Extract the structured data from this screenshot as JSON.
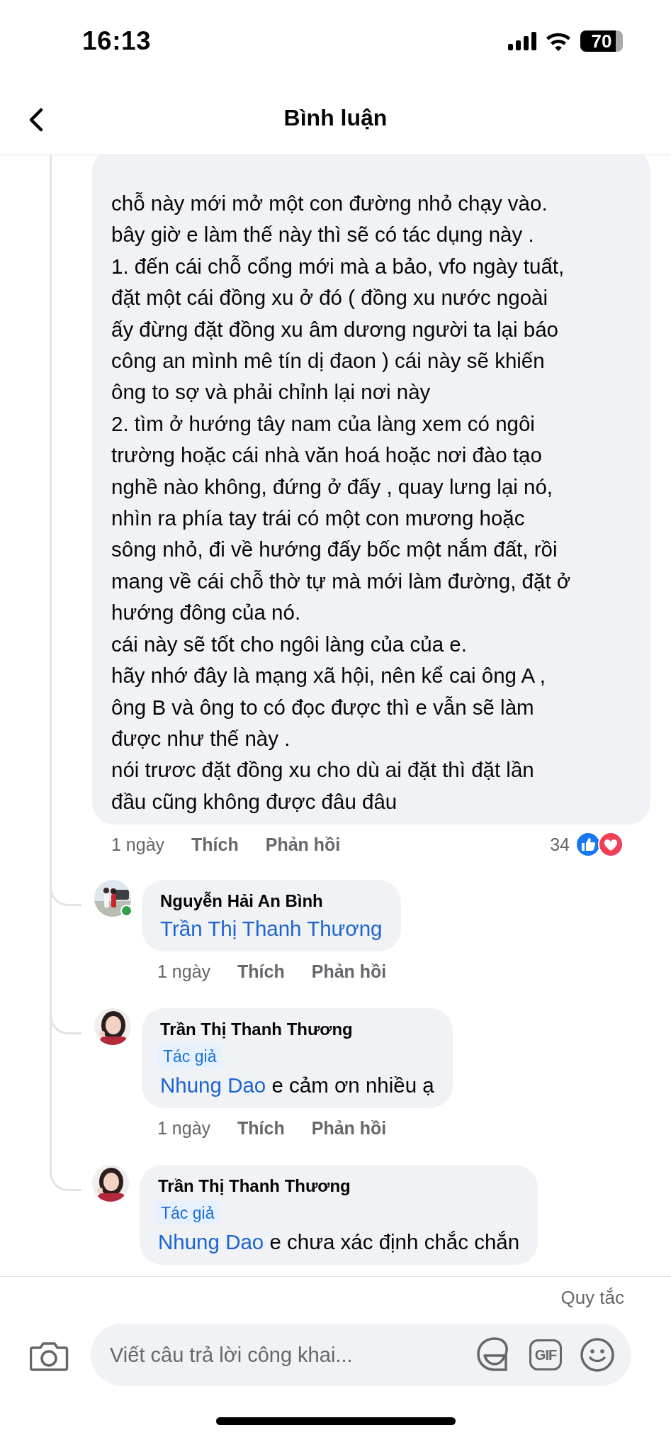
{
  "status_bar": {
    "time": "16:13",
    "battery": "70"
  },
  "header": {
    "title": "Bình luận"
  },
  "comment": {
    "text": "chỗ này mới mở một con đường nhỏ chạy vào.\nbây giờ e làm thế này thì sẽ có tác dụng này .\n1. đến cái chỗ cổng mới mà a bảo, vfo ngày tuất,\nđặt một cái đồng xu ở đó ( đồng xu nước ngoài\nấy đừng đặt đồng xu âm dương người ta lại báo\ncông an mình mê tín dị đaon ) cái này sẽ khiến\nông to sợ và phải chỉnh lại nơi này\n2. tìm ở hướng tây nam của làng xem có ngôi\ntrường hoặc cái nhà văn hoá hoặc nơi đào tạo\nnghề nào không, đứng ở đấy , quay lưng lại nó,\nnhìn ra phía tay trái có một con mương hoặc\nsông nhỏ, đi về hướng đấy bốc một nắm đất, rồi\nmang về cái chỗ thờ tự mà mới làm đường, đặt ở\nhướng đông của nó.\ncái này sẽ tốt cho ngôi làng của của e.\nhãy nhớ đây là mạng xã hội, nên kể cai ông A ,\nông B và ông to có đọc được thì e vẫn sẽ làm\nđược như thế này .\nnói trươc đặt đồng xu cho dù ai đặt thì đặt lần\nđầu cũng không được đâu đâu",
    "time": "1 ngày",
    "like": "Thích",
    "reply": "Phản hồi",
    "reaction_count": "34"
  },
  "replies": [
    {
      "author": "Nguyễn Hải An Bình",
      "online": true,
      "mention": "Trần Thị Thanh Thương",
      "time": "1 ngày",
      "like": "Thích",
      "reply": "Phản hồi"
    },
    {
      "author": "Trần Thị Thanh Thương",
      "online": false,
      "badge": "Tác giả",
      "mention": "Nhung Dao",
      "text": " e cảm ơn nhiều ạ",
      "time": "1 ngày",
      "like": "Thích",
      "reply": "Phản hồi"
    },
    {
      "author": "Trần Thị Thanh Thương",
      "online": false,
      "badge": "Tác giả",
      "mention": "Nhung Dao",
      "text": " e chưa xác định chắc chắn"
    }
  ],
  "composer": {
    "rules": "Quy tắc",
    "placeholder": "Viết câu trả lời công khai...",
    "gif": "GIF"
  }
}
